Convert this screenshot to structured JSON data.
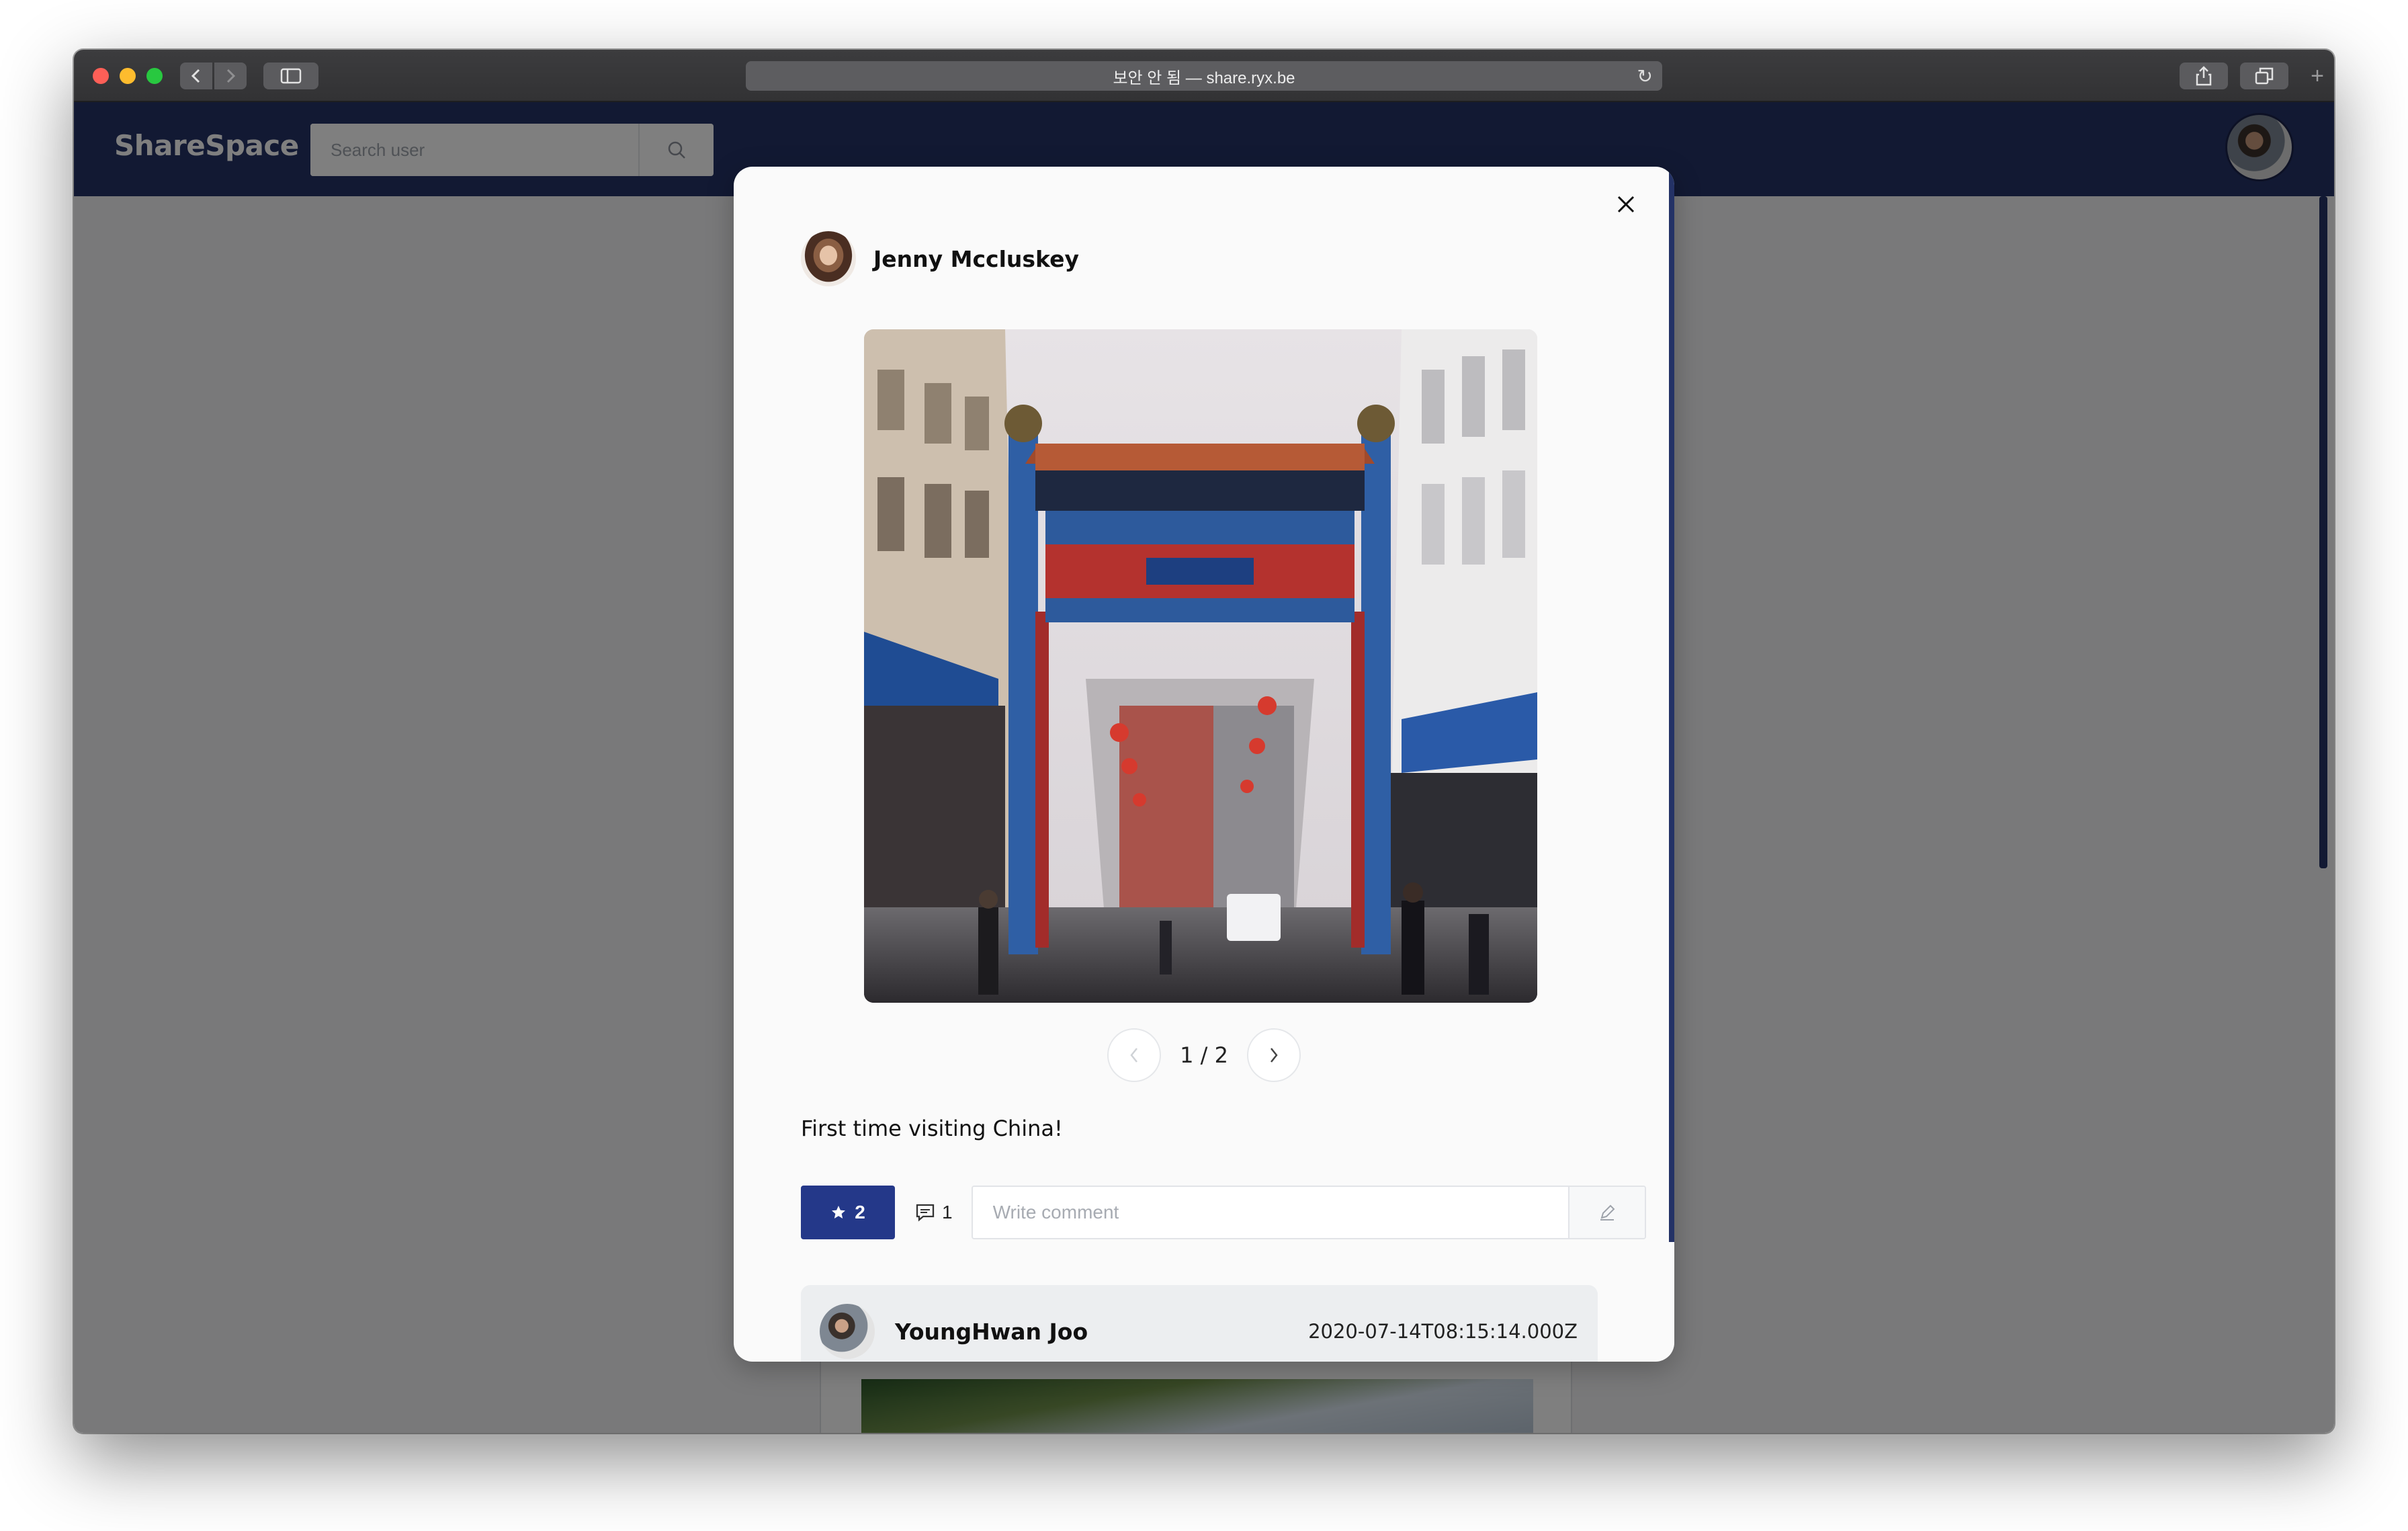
{
  "browser": {
    "address": "보안 안 됨 — share.ryx.be"
  },
  "app": {
    "brand": "ShareSpace",
    "search": {
      "placeholder": "Search user",
      "value": ""
    }
  },
  "post": {
    "author": "Jenny Mccluskey",
    "pager": "1 / 2",
    "caption": "First time visiting China!",
    "likes": "2",
    "comments_count": "1",
    "comment_input": {
      "placeholder": "Write comment",
      "value": ""
    }
  },
  "comments": [
    {
      "author": "YoungHwan Joo",
      "time": "2020-07-14T08:15:14.000Z"
    }
  ],
  "colors": {
    "brand_navy": "#243266",
    "like_button": "#243889"
  },
  "icons": {
    "close": "close-icon",
    "search": "search-icon",
    "star": "star-icon",
    "comment": "comment-icon",
    "submit": "edit-pen-icon",
    "prev": "chevron-left-icon",
    "next": "chevron-right-icon"
  }
}
